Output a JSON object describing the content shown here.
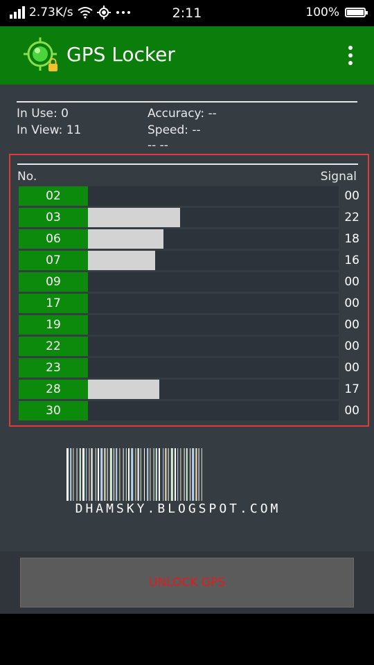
{
  "status_bar": {
    "network_speed": "2.73K/s",
    "time": "2:11",
    "battery": "100%"
  },
  "app": {
    "title": "GPS Locker",
    "accent": "#0b7d0b"
  },
  "info": {
    "in_use": "In Use: 0",
    "in_view": "In View: 11",
    "accuracy": "Accuracy: --",
    "speed": "Speed: --",
    "extra": "-- --"
  },
  "satellites": {
    "header_no": "No.",
    "header_signal": "Signal",
    "max_signal": 60,
    "rows": [
      {
        "no": "02",
        "signal": "00",
        "level": 0
      },
      {
        "no": "03",
        "signal": "22",
        "level": 22
      },
      {
        "no": "06",
        "signal": "18",
        "level": 18
      },
      {
        "no": "07",
        "signal": "16",
        "level": 16
      },
      {
        "no": "09",
        "signal": "00",
        "level": 0
      },
      {
        "no": "17",
        "signal": "00",
        "level": 0
      },
      {
        "no": "19",
        "signal": "00",
        "level": 0
      },
      {
        "no": "22",
        "signal": "00",
        "level": 0
      },
      {
        "no": "23",
        "signal": "00",
        "level": 0
      },
      {
        "no": "28",
        "signal": "17",
        "level": 17
      },
      {
        "no": "30",
        "signal": "00",
        "level": 0
      }
    ]
  },
  "footer": {
    "text": "DHAMSKY.BLOGSPOT.COM"
  },
  "button": {
    "unlock_label": "UNLOCK GPS"
  }
}
